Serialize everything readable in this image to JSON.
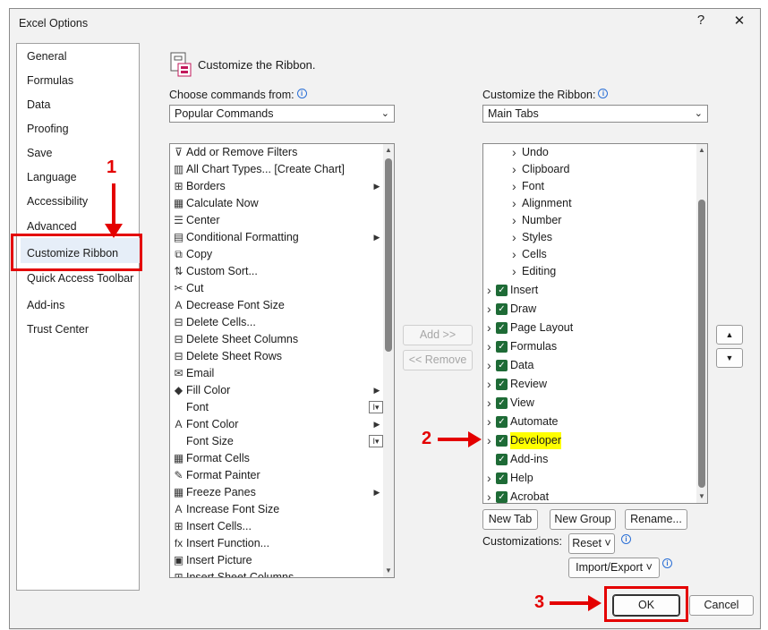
{
  "window": {
    "title": "Excel Options",
    "help": "?",
    "close": "✕"
  },
  "nav": {
    "items": [
      {
        "label": "General"
      },
      {
        "label": "Formulas"
      },
      {
        "label": "Data"
      },
      {
        "label": "Proofing"
      },
      {
        "label": "Save"
      },
      {
        "label": "Language"
      },
      {
        "label": "Accessibility"
      },
      {
        "label": "Advanced"
      },
      {
        "label": "Customize Ribbon"
      },
      {
        "label": "Quick Access Toolbar"
      },
      {
        "label": "Add-ins"
      },
      {
        "label": "Trust Center"
      }
    ],
    "selected": "Customize Ribbon"
  },
  "annotations": {
    "step1": "1",
    "step2": "2",
    "step3": "3",
    "color": "#e40000"
  },
  "header": {
    "title": "Customize the Ribbon."
  },
  "left": {
    "label": "Choose commands from:",
    "combo_value": "Popular Commands",
    "commands": [
      {
        "label": "Add or Remove Filters",
        "icon": "filter-icon",
        "glyph": "⊽"
      },
      {
        "label": "All Chart Types... [Create Chart]",
        "icon": "chart-icon",
        "glyph": "▥"
      },
      {
        "label": "Borders",
        "icon": "borders-icon",
        "glyph": "⊞",
        "submenu": true
      },
      {
        "label": "Calculate Now",
        "icon": "calculator-icon",
        "glyph": "▦"
      },
      {
        "label": "Center",
        "icon": "center-align-icon",
        "glyph": "☰"
      },
      {
        "label": "Conditional Formatting",
        "icon": "conditional-formatting-icon",
        "glyph": "▤",
        "submenu": true
      },
      {
        "label": "Copy",
        "icon": "copy-icon",
        "glyph": "⧉"
      },
      {
        "label": "Custom Sort...",
        "icon": "sort-icon",
        "glyph": "⇅"
      },
      {
        "label": "Cut",
        "icon": "scissors-icon",
        "glyph": "✂"
      },
      {
        "label": "Decrease Font Size",
        "icon": "decrease-font-icon",
        "glyph": "A"
      },
      {
        "label": "Delete Cells...",
        "icon": "delete-cells-icon",
        "glyph": "⊟"
      },
      {
        "label": "Delete Sheet Columns",
        "icon": "delete-columns-icon",
        "glyph": "⊟"
      },
      {
        "label": "Delete Sheet Rows",
        "icon": "delete-rows-icon",
        "glyph": "⊟"
      },
      {
        "label": "Email",
        "icon": "email-icon",
        "glyph": "✉"
      },
      {
        "label": "Fill Color",
        "icon": "fill-color-icon",
        "glyph": "◆",
        "submenu": true
      },
      {
        "label": "Font",
        "icon": "",
        "glyph": "",
        "selector": true
      },
      {
        "label": "Font Color",
        "icon": "font-color-icon",
        "glyph": "A",
        "submenu": true
      },
      {
        "label": "Font Size",
        "icon": "",
        "glyph": "",
        "selector": true
      },
      {
        "label": "Format Cells",
        "icon": "format-cells-icon",
        "glyph": "▦"
      },
      {
        "label": "Format Painter",
        "icon": "format-painter-icon",
        "glyph": "✎"
      },
      {
        "label": "Freeze Panes",
        "icon": "freeze-panes-icon",
        "glyph": "▦",
        "submenu": true
      },
      {
        "label": "Increase Font Size",
        "icon": "increase-font-icon",
        "glyph": "A"
      },
      {
        "label": "Insert Cells...",
        "icon": "insert-cells-icon",
        "glyph": "⊞"
      },
      {
        "label": "Insert Function...",
        "icon": "function-icon",
        "glyph": "fx"
      },
      {
        "label": "Insert Picture",
        "icon": "picture-icon",
        "glyph": "▣"
      },
      {
        "label": "Insert Sheet Columns",
        "icon": "insert-columns-icon",
        "glyph": "⊞"
      }
    ]
  },
  "middle": {
    "add": "Add >>",
    "remove": "<< Remove"
  },
  "right": {
    "label": "Customize the Ribbon:",
    "combo_value": "Main Tabs",
    "home_groups": [
      "Undo",
      "Clipboard",
      "Font",
      "Alignment",
      "Number",
      "Styles",
      "Cells",
      "Editing"
    ],
    "tabs": [
      {
        "label": "Insert",
        "expand": true,
        "checked": true
      },
      {
        "label": "Draw",
        "expand": true,
        "checked": true
      },
      {
        "label": "Page Layout",
        "expand": true,
        "checked": true
      },
      {
        "label": "Formulas",
        "expand": true,
        "checked": true
      },
      {
        "label": "Data",
        "expand": true,
        "checked": true
      },
      {
        "label": "Review",
        "expand": true,
        "checked": true
      },
      {
        "label": "View",
        "expand": true,
        "checked": true
      },
      {
        "label": "Automate",
        "expand": true,
        "checked": true
      },
      {
        "label": "Developer",
        "expand": true,
        "checked": true,
        "highlight": true
      },
      {
        "label": "Add-ins",
        "expand": false,
        "checked": true
      },
      {
        "label": "Help",
        "expand": true,
        "checked": true
      },
      {
        "label": "Acrobat",
        "expand": true,
        "checked": true
      }
    ],
    "new_tab": "New Tab",
    "new_group": "New Group",
    "rename": "Rename...",
    "customizations_label": "Customizations:",
    "reset": "Reset ˅",
    "import_export": "Import/Export ˅"
  },
  "footer": {
    "ok": "OK",
    "cancel": "Cancel"
  }
}
